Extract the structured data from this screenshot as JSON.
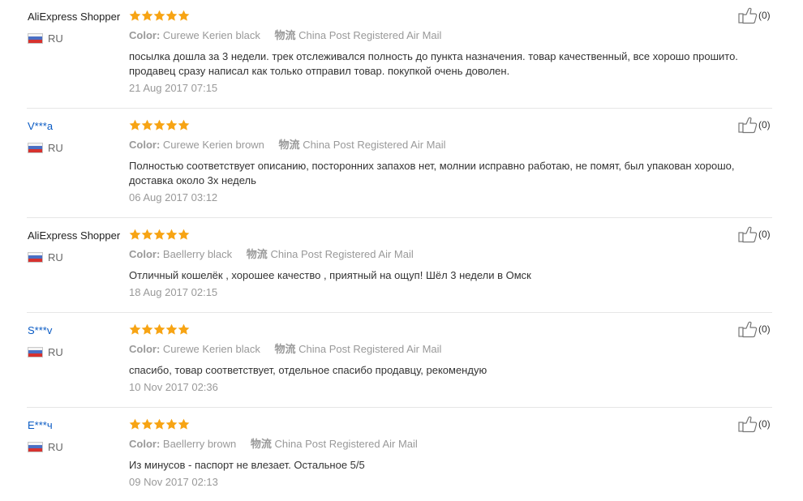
{
  "reviews": [
    {
      "user": "AliExpress Shopper",
      "country": "RU",
      "rating": 5,
      "color_label": "Color:",
      "color_value": "Curewe Kerien black",
      "shipping_label": "物流",
      "shipping_value": "China Post Registered Air Mail",
      "text": "посылка дошла за 3 недели. трек отслеживался полность до пункта назначения. товар качественный, все хорошо прошито. продавец сразу написал как только отправил товар. покупкой очень доволен.",
      "date": "21 Aug 2017 07:15",
      "helpful": "(0)"
    },
    {
      "user": "V***a",
      "country": "RU",
      "rating": 5,
      "color_label": "Color:",
      "color_value": "Curewe Kerien brown",
      "shipping_label": "物流",
      "shipping_value": "China Post Registered Air Mail",
      "text": "Полностью соответствует описанию, посторонних запахов нет, молнии исправно работаю, не помят, был упакован хорошо, доставка около 3х недель",
      "date": "06 Aug 2017 03:12",
      "helpful": "(0)"
    },
    {
      "user": "AliExpress Shopper",
      "country": "RU",
      "rating": 5,
      "color_label": "Color:",
      "color_value": "Baellerry black",
      "shipping_label": "物流",
      "shipping_value": "China Post Registered Air Mail",
      "text": "Отличный кошелёк , хорошее качество , приятный на ощуп! Шёл 3 недели в Омск",
      "date": "18 Aug 2017 02:15",
      "helpful": "(0)"
    },
    {
      "user": "S***v",
      "country": "RU",
      "rating": 5,
      "color_label": "Color:",
      "color_value": "Curewe Kerien black",
      "shipping_label": "物流",
      "shipping_value": "China Post Registered Air Mail",
      "text": "спасибо, товар соответствует, отдельное спасибо продавцу, рекомендую",
      "date": "10 Nov 2017 02:36",
      "helpful": "(0)"
    },
    {
      "user": "E***ч",
      "country": "RU",
      "rating": 5,
      "color_label": "Color:",
      "color_value": "Baellerry brown",
      "shipping_label": "物流",
      "shipping_value": "China Post Registered Air Mail",
      "text": "Из минусов - паспорт не влезает. Остальное 5/5",
      "date": "09 Nov 2017 02:13",
      "helpful": "(0)"
    }
  ],
  "icons": {
    "star": "star-icon",
    "helpful": "thumbs-up-icon",
    "flag": "russia-flag-icon"
  },
  "colors": {
    "star": "#f7a414",
    "masked_user": "#0a5bc4",
    "meta_text": "#999999",
    "divider": "#e6e6e6"
  }
}
